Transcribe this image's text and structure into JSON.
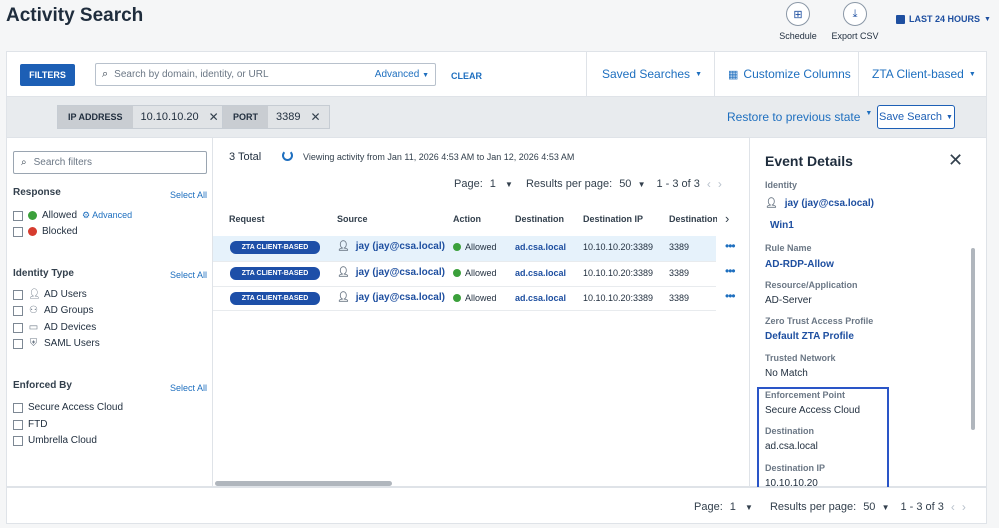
{
  "header": {
    "title": "Activity Search",
    "schedule_label": "Schedule",
    "export_label": "Export CSV",
    "time_range": "LAST 24 HOURS"
  },
  "filter_bar": {
    "filters_label": "FILTERS",
    "search_placeholder": "Search by domain, identity, or URL",
    "advanced_label": "Advanced",
    "clear_label": "CLEAR",
    "saved_searches": "Saved Searches",
    "customize_columns": "Customize Columns",
    "zta_filter": "ZTA Client-based"
  },
  "chips": [
    {
      "key": "IP ADDRESS",
      "value": "10.10.10.20"
    },
    {
      "key": "PORT",
      "value": "3389"
    }
  ],
  "chips_actions": {
    "restore": "Restore to previous state",
    "save_search": "Save Search"
  },
  "left_panel": {
    "search_placeholder": "Search filters",
    "select_all": "Select All",
    "response": {
      "title": "Response",
      "allowed": "Allowed",
      "advanced": "Advanced",
      "blocked": "Blocked"
    },
    "identity": {
      "title": "Identity Type",
      "items": [
        "AD Users",
        "AD Groups",
        "AD Devices",
        "SAML Users"
      ]
    },
    "enforced": {
      "title": "Enforced By",
      "items": [
        "Secure Access Cloud",
        "FTD",
        "Umbrella Cloud"
      ]
    }
  },
  "results": {
    "total": "3 Total",
    "viewing": "Viewing activity from Jan 11, 2026 4:53 AM to Jan 12, 2026 4:53 AM",
    "page_label": "Page:",
    "page_value": "1",
    "rpp_label": "Results per page:",
    "rpp_value": "50",
    "range": "1 - 3 of 3",
    "columns": [
      "Request",
      "Source",
      "Action",
      "Destination",
      "Destination IP",
      "Destination Po"
    ],
    "rows": [
      {
        "request": "ZTA CLIENT-BASED",
        "source": "jay (jay@csa.local)",
        "action": "Allowed",
        "destination": "ad.csa.local",
        "destination_ip": "10.10.10.20:3389",
        "port": "3389"
      },
      {
        "request": "ZTA CLIENT-BASED",
        "source": "jay (jay@csa.local)",
        "action": "Allowed",
        "destination": "ad.csa.local",
        "destination_ip": "10.10.10.20:3389",
        "port": "3389"
      },
      {
        "request": "ZTA CLIENT-BASED",
        "source": "jay (jay@csa.local)",
        "action": "Allowed",
        "destination": "ad.csa.local",
        "destination_ip": "10.10.10.20:3389",
        "port": "3389"
      }
    ]
  },
  "event_details": {
    "title": "Event Details",
    "identity_label": "Identity",
    "identity_value": "jay (jay@csa.local)",
    "identity_device": "Win1",
    "rule_label": "Rule Name",
    "rule_value": "AD-RDP-Allow",
    "resource_label": "Resource/Application",
    "resource_value": "AD-Server",
    "zta_profile_label": "Zero Trust Access Profile",
    "zta_profile_value": "Default ZTA Profile",
    "trusted_label": "Trusted Network",
    "trusted_value": "No Match",
    "enforcement_label": "Enforcement Point",
    "enforcement_value": "Secure Access Cloud",
    "destination_label": "Destination",
    "destination_value": "ad.csa.local",
    "destination_ip_label": "Destination IP",
    "destination_ip_value": "10.10.10.20"
  },
  "footer": {
    "page_label": "Page:",
    "page_value": "1",
    "rpp_label": "Results per page:",
    "rpp_value": "50",
    "range": "1 - 3 of 3"
  }
}
